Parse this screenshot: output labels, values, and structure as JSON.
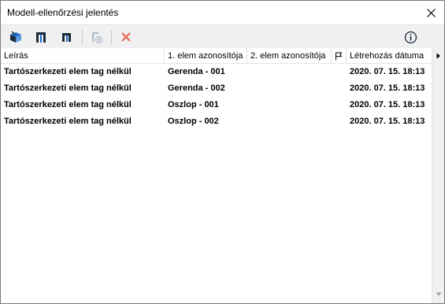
{
  "window": {
    "title": "Modell-ellenőrzési jelentés"
  },
  "titlebar": {
    "close_icon": "close-icon"
  },
  "toolbar": {
    "buttons": [
      {
        "name": "zoom-to-elements-icon"
      },
      {
        "name": "select-elements-icon"
      },
      {
        "name": "select-in-view-icon"
      },
      {
        "name": "add-element-icon"
      },
      {
        "name": "delete-icon"
      },
      {
        "name": "info-icon"
      }
    ],
    "colors": {
      "blue": "#1e6fc9",
      "dark": "#1b2a3b",
      "red": "#e8614d",
      "disabled": "#a9b8c8"
    }
  },
  "grid": {
    "columns": [
      "Leírás",
      "1. elem azonosítója",
      "2. elem azonosítója",
      "",
      "Létrehozás dátuma"
    ],
    "rows": [
      [
        "Tartószerkezeti elem tag nélkül",
        "Gerenda - 001",
        "",
        "",
        "2020. 07. 15. 18:13"
      ],
      [
        "Tartószerkezeti elem tag nélkül",
        "Gerenda - 002",
        "",
        "",
        "2020. 07. 15. 18:13"
      ],
      [
        "Tartószerkezeti elem tag nélkül",
        "Oszlop - 001",
        "",
        "",
        "2020. 07. 15. 18:13"
      ],
      [
        "Tartószerkezeti elem tag nélkül",
        "Oszlop - 002",
        "",
        "",
        "2020. 07. 15. 18:13"
      ]
    ]
  }
}
